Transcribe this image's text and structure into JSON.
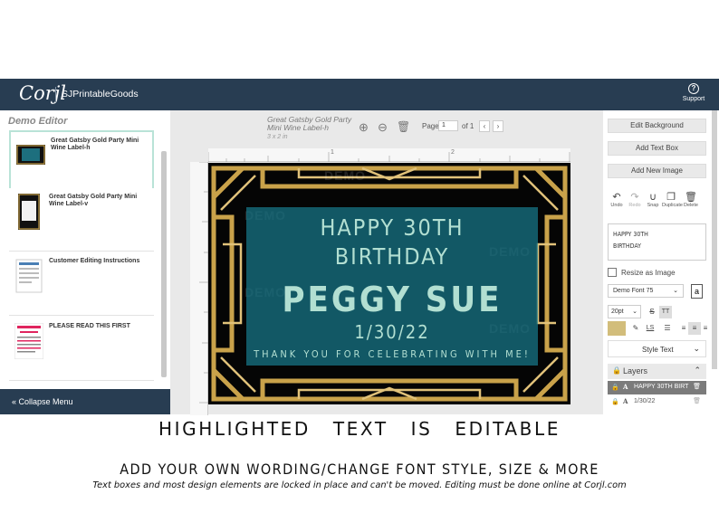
{
  "topbar": {
    "logo": "Corjl",
    "shop": "SJPrintableGoods",
    "support": "Support"
  },
  "left_panel": {
    "title": "Demo Editor",
    "templates": [
      {
        "label": "Great Gatsby Gold Party Mini Wine Label-h",
        "selected": true
      },
      {
        "label": "Great Gatsby Gold Party Mini Wine Label-v",
        "selected": false
      },
      {
        "label": "Customer Editing Instructions",
        "selected": false
      },
      {
        "label": "PLEASE READ THIS FIRST",
        "selected": false
      }
    ],
    "thumb_attention": "ATTENTION!! Read This First",
    "collapse_label": "Collapse Menu"
  },
  "toolbar": {
    "doc_title": "Great Gatsby Gold Party Mini Wine Label-h",
    "doc_size": "3 x 2 in",
    "page_label": "Page",
    "page_value": "1",
    "page_of": "of 1"
  },
  "ruler": {
    "marks": [
      "1",
      "2"
    ]
  },
  "canvas": {
    "line1": "HAPPY 30TH",
    "line2": "BIRTHDAY",
    "name": "PEGGY SUE",
    "date": "1/30/22",
    "thanks": "THANK YOU FOR CELEBRATING WITH ME!",
    "watermark": "DEMO",
    "colors": {
      "gold": "#c9a24a",
      "teal_box": "#18788a",
      "text": "#b2dfd2",
      "background": "#050505"
    }
  },
  "right_panel": {
    "edit_background": "Edit Background",
    "add_text_box": "Add Text Box",
    "add_new_image": "Add New Image",
    "actions": [
      {
        "label": "Undo",
        "icon": "undo-icon"
      },
      {
        "label": "Redo",
        "icon": "redo-icon"
      },
      {
        "label": "Snap",
        "icon": "magnet-icon"
      },
      {
        "label": "Duplicate",
        "icon": "duplicate-icon"
      },
      {
        "label": "Delete",
        "icon": "trash-icon"
      }
    ],
    "preview_line1": "HAPPY 30TH",
    "preview_line2": "BIRTHDAY",
    "resize_label": "Resize as Image",
    "font_value": "Demo Font 75",
    "size_value": "20pt",
    "color_swatch": "#d2bd7b",
    "style_text": "Style Text",
    "layers_label": "Layers",
    "layers": [
      {
        "name": "HAPPY 30TH BIRT",
        "active": true
      },
      {
        "name": "1/30/22",
        "active": false
      }
    ]
  },
  "captions": {
    "headline": "HIGHLIGHTED TEXT IS EDITABLE",
    "subhead": "ADD YOUR OWN WORDING/CHANGE FONT STYLE, SIZE & MORE",
    "note": "Text boxes and most design elements are locked in place and can't be moved. Editing must be done online at Corjl.com"
  }
}
